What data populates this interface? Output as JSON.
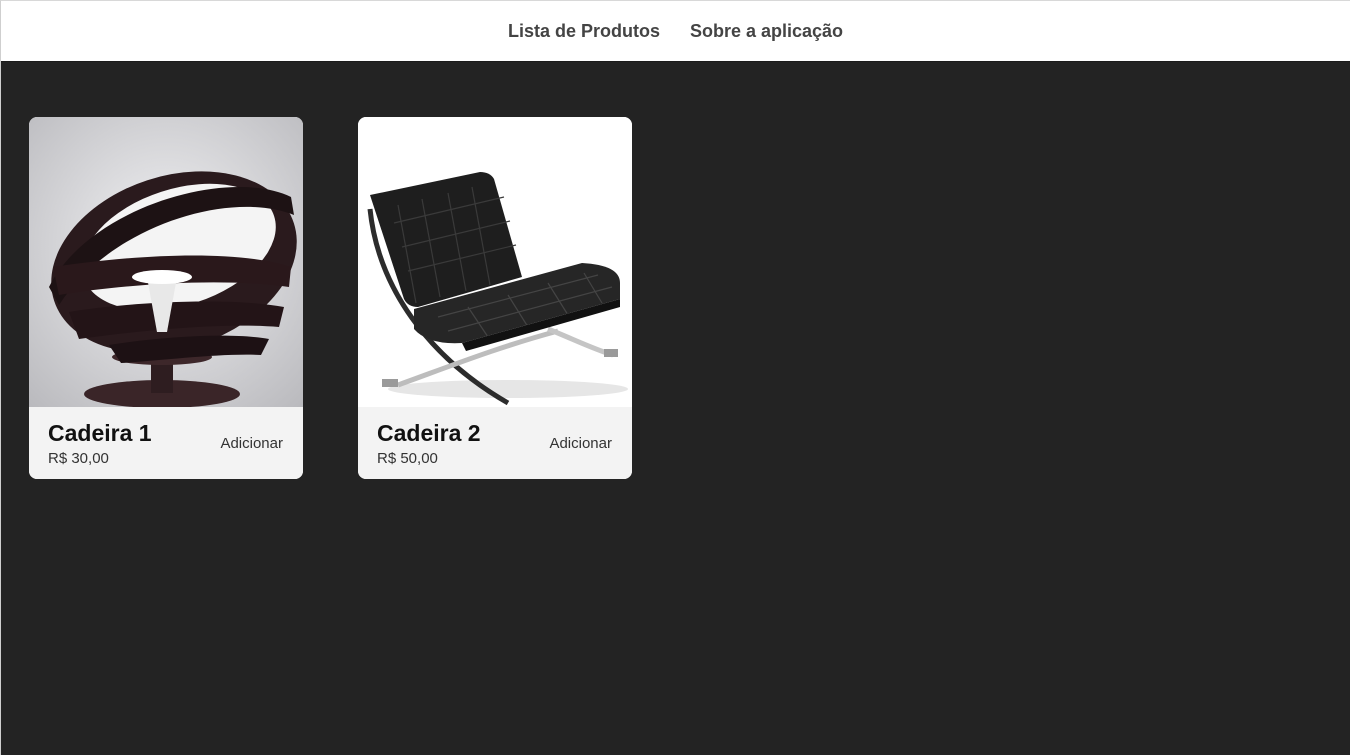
{
  "nav": {
    "items": [
      {
        "label": "Lista de Produtos"
      },
      {
        "label": "Sobre a aplicação"
      }
    ]
  },
  "products": [
    {
      "name": "Cadeira 1",
      "price": "R$ 30,00",
      "action_label": "Adicionar",
      "image": "ribbon-egg-chair-photo"
    },
    {
      "name": "Cadeira 2",
      "price": "R$ 50,00",
      "action_label": "Adicionar",
      "image": "black-leather-lounge-chair-photo"
    }
  ],
  "colors": {
    "background": "#232323",
    "nav_background": "#ffffff",
    "card_background": "#f3f3f3",
    "nav_text": "#444444"
  }
}
